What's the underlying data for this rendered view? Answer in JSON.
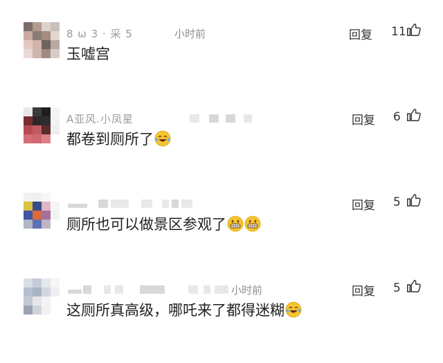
{
  "comments": [
    {
      "name_partial": "8 ω  3 · 采 5",
      "time_partial": "小时前",
      "text": "玉嘘宫",
      "reply_label": "回复",
      "likes": "11",
      "emoji": ""
    },
    {
      "name_partial": "A亚风.小凤星",
      "time_partial": "",
      "text": "都卷到厕所了",
      "reply_label": "回复",
      "likes": "6",
      "emoji": "face-with-tears-of-joy-icon"
    },
    {
      "name_partial": "",
      "time_partial": "",
      "text": "厕所也可以做景区参观了",
      "reply_label": "回复",
      "likes": "5",
      "emoji": "grinning-face-icon x2"
    },
    {
      "name_partial": "",
      "time_partial": "小时前",
      "text": "这厕所真高级，哪吒来了都得迷糊",
      "reply_label": "回复",
      "likes": "5",
      "emoji": "face-with-tears-of-joy-icon"
    }
  ],
  "colors": {
    "text": "#1e1e1e",
    "meta": "#8d8d8d",
    "emoji_yellow": "#f6c431"
  }
}
